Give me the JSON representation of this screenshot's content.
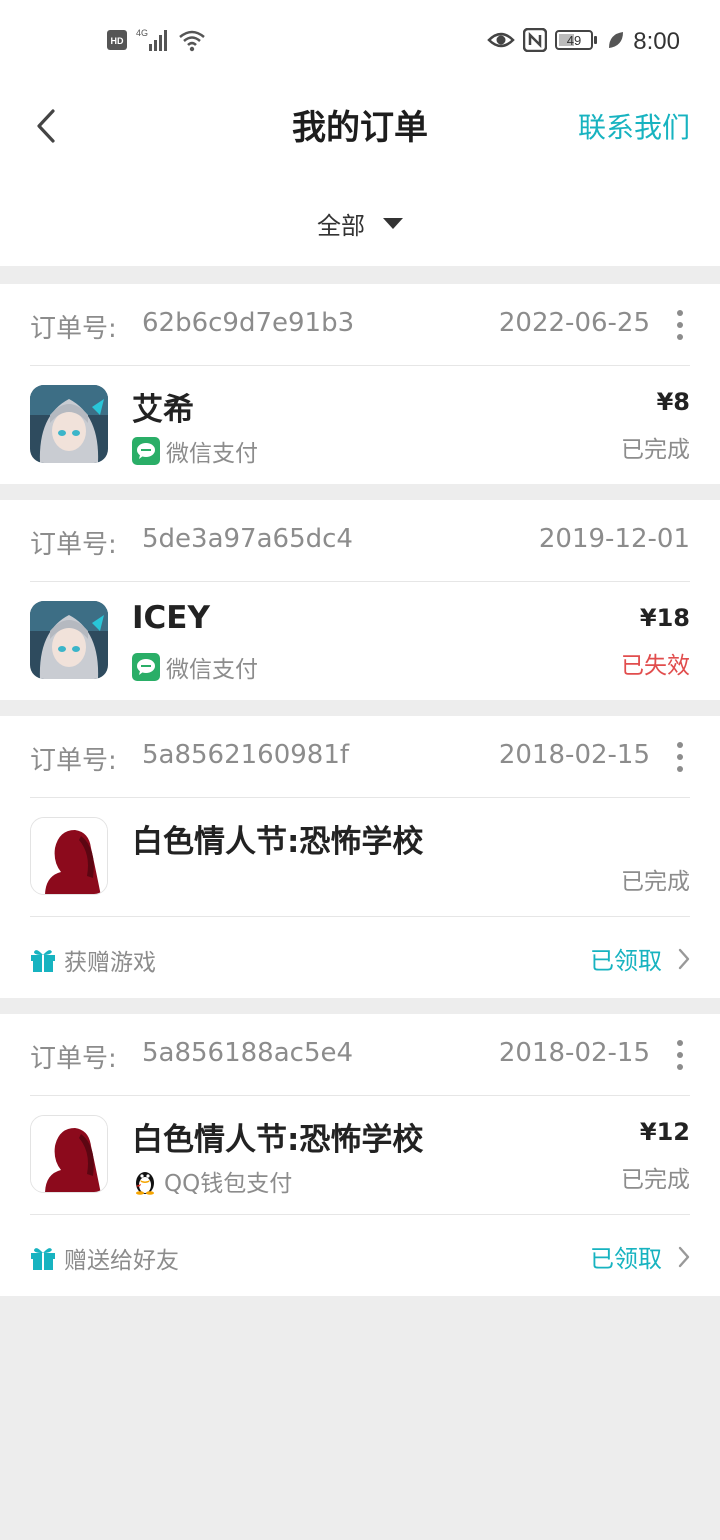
{
  "status_bar": {
    "hd": "HD",
    "network": "4G",
    "battery": "49",
    "time": "8:00"
  },
  "header": {
    "title": "我的订单",
    "contact_label": "联系我们",
    "filter_label": "全部"
  },
  "orders": [
    {
      "id_label": "订单号:",
      "id": "62b6c9d7e91b3",
      "date": "2022-06-25",
      "game_name": "艾希",
      "pay_method": "微信支付",
      "price": "¥8",
      "status": "已完成"
    },
    {
      "id_label": "订单号:",
      "id": "5de3a97a65dc4",
      "date": "2019-12-01",
      "game_name": "ICEY",
      "pay_method": "微信支付",
      "price": "¥18",
      "status": "已失效"
    },
    {
      "id_label": "订单号:",
      "id": "5a8562160981f",
      "date": "2018-02-15",
      "game_name": "白色情人节:恐怖学校",
      "status": "已完成",
      "gift_label": "获赠游戏",
      "claim_label": "已领取"
    },
    {
      "id_label": "订单号:",
      "id": "5a856188ac5e4",
      "date": "2018-02-15",
      "game_name": "白色情人节:恐怖学校",
      "pay_method": "QQ钱包支付",
      "price": "¥12",
      "status": "已完成",
      "gift_label": "赠送给好友",
      "claim_label": "已领取"
    }
  ],
  "colors": {
    "accent": "#17b3c0",
    "failed": "#e14d4d",
    "muted": "#8c8c8c",
    "wechat": "#2aae67"
  }
}
